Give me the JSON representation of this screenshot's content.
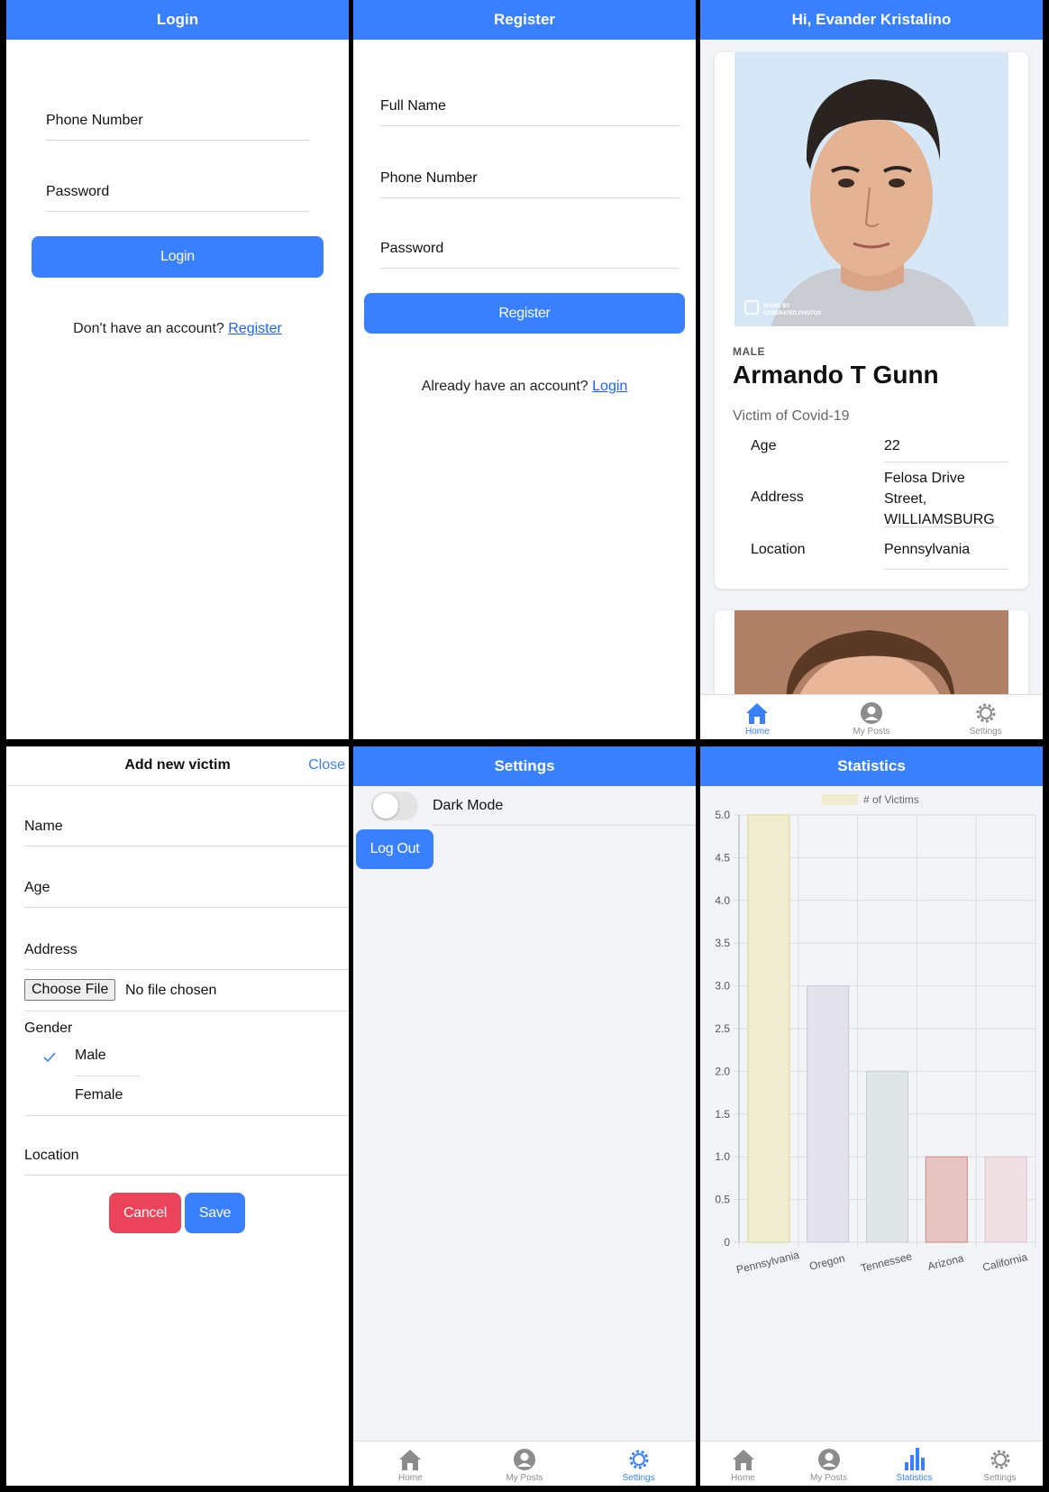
{
  "login": {
    "title": "Login",
    "phone_label": "Phone Number",
    "password_label": "Password",
    "login_button": "Login",
    "prompt": "Don't have an account?",
    "register_link": "Register"
  },
  "register": {
    "title": "Register",
    "fullname_label": "Full Name",
    "phone_label": "Phone Number",
    "password_label": "Password",
    "register_button": "Register",
    "prompt": "Already have an account?",
    "login_link": "Login"
  },
  "home": {
    "title": "Hi, Evander Kristalino",
    "card": {
      "gender": "MALE",
      "name": "Armando T Gunn",
      "subtitle": "Victim of Covid-19",
      "watermark": "IMAGE BY GENERATED.PHOTOS",
      "rows": [
        {
          "label": "Age",
          "value": "22"
        },
        {
          "label": "Address",
          "value": "Felosa Drive Street, WILLIAMSBURG"
        },
        {
          "label": "Location",
          "value": "Pennsylvania"
        }
      ]
    }
  },
  "tabs": {
    "home": "Home",
    "my_posts": "My Posts",
    "settings": "Settings",
    "statistics": "Statistics"
  },
  "add_victim": {
    "title": "Add new victim",
    "close": "Close",
    "name_label": "Name",
    "age_label": "Age",
    "address_label": "Address",
    "file_button": "Choose File",
    "file_status": "No file chosen",
    "gender_label": "Gender",
    "gender_options": [
      "Male",
      "Female"
    ],
    "gender_selected": "Male",
    "location_label": "Location",
    "cancel_button": "Cancel",
    "save_button": "Save"
  },
  "settings": {
    "title": "Settings",
    "dark_mode_label": "Dark Mode",
    "dark_mode_on": false,
    "logout_button": "Log Out"
  },
  "statistics": {
    "title": "Statistics"
  },
  "colors": {
    "primary": "#3880ff",
    "danger": "#eb445a",
    "background": "#f3f4f7"
  },
  "chart_data": {
    "type": "bar",
    "categories": [
      "Pennsylvania",
      "Oregon",
      "Tennessee",
      "Arizona",
      "California"
    ],
    "series": [
      {
        "name": "# of Victims",
        "values": [
          5,
          3,
          2,
          1,
          1
        ]
      }
    ],
    "bar_colors": [
      "#f0ecd0",
      "#e3e2ec",
      "#e0e6e6",
      "#e5c4c2",
      "#efe0e3"
    ],
    "bar_borders": [
      "#ddd49a",
      "#c9c7d8",
      "#c3cfcf",
      "#c98c89",
      "#dcc3c8"
    ],
    "ylim": [
      0,
      5
    ],
    "yticks": [
      "0",
      "0.5",
      "1.0",
      "1.5",
      "2.0",
      "2.5",
      "3.0",
      "3.5",
      "4.0",
      "4.5",
      "5.0"
    ],
    "grid": true,
    "legend": "top"
  }
}
